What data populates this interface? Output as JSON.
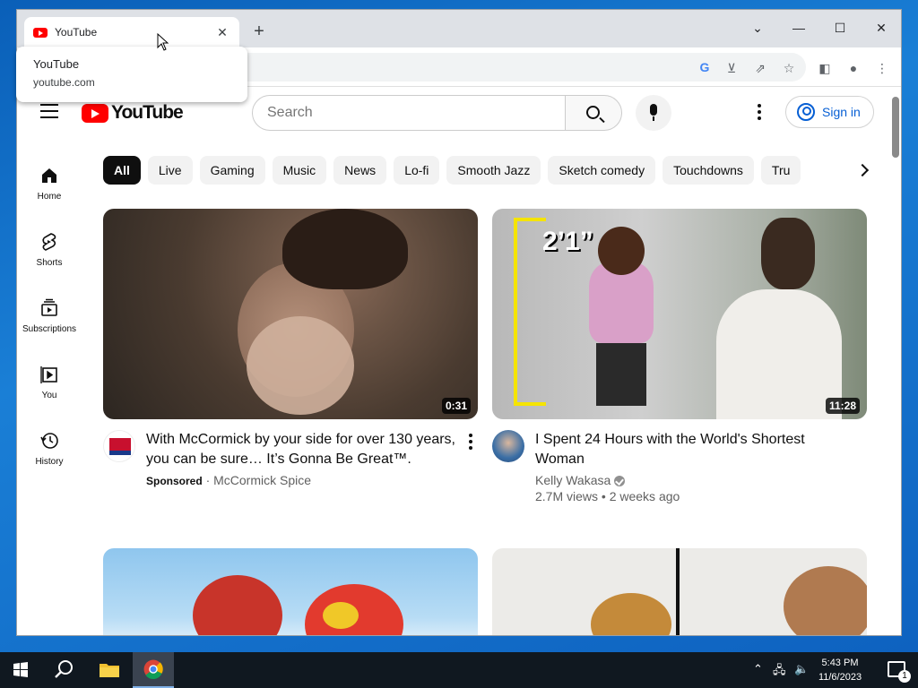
{
  "browser": {
    "tab_title": "YouTube",
    "tooltip": {
      "title": "YouTube",
      "url": "youtube.com"
    }
  },
  "youtube": {
    "logo_text": "YouTube",
    "search_placeholder": "Search",
    "sign_in_label": "Sign in",
    "chips": [
      "All",
      "Live",
      "Gaming",
      "Music",
      "News",
      "Lo-fi",
      "Smooth Jazz",
      "Sketch comedy",
      "Touchdowns",
      "Tru"
    ],
    "sidebar": [
      {
        "label": "Home",
        "icon": "home-icon"
      },
      {
        "label": "Shorts",
        "icon": "shorts-icon"
      },
      {
        "label": "Subscriptions",
        "icon": "subscriptions-icon"
      },
      {
        "label": "You",
        "icon": "you-icon"
      },
      {
        "label": "History",
        "icon": "history-icon"
      }
    ],
    "videos": [
      {
        "title": "With McCormick by your side for over 130 years, you can be sure… It’s Gonna Be Great™.",
        "badge": "Sponsored",
        "channel": "McCormick Spice",
        "duration": "0:31"
      },
      {
        "title": "I Spent 24 Hours with the World's Shortest Woman",
        "channel": "Kelly Wakasa",
        "stats": "2.7M views • 2 weeks ago",
        "duration": "11:28",
        "thumb_text": "2’1”"
      }
    ]
  },
  "taskbar": {
    "time": "5:43 PM",
    "date": "11/6/2023",
    "notification_count": "1"
  }
}
